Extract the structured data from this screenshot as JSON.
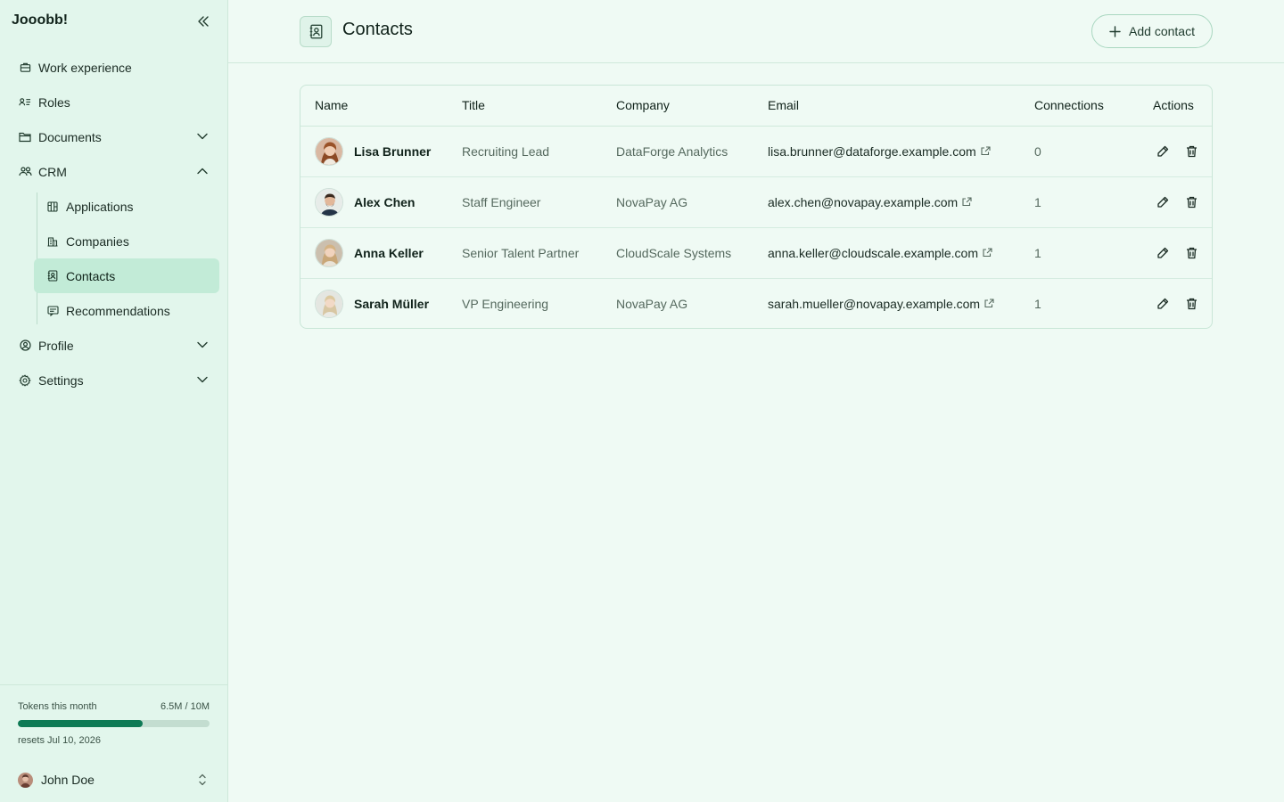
{
  "app": {
    "brand": "Jooobb!"
  },
  "sidebar": {
    "items": [
      {
        "label": "Work experience",
        "icon": "briefcase-icon"
      },
      {
        "label": "Roles",
        "icon": "roles-icon"
      },
      {
        "label": "Documents",
        "icon": "folder-icon",
        "expanded": false
      },
      {
        "label": "CRM",
        "icon": "users-icon",
        "expanded": true
      }
    ],
    "crm_children": [
      {
        "label": "Applications",
        "icon": "kanban-icon"
      },
      {
        "label": "Companies",
        "icon": "building-icon"
      },
      {
        "label": "Contacts",
        "icon": "contact-book-icon",
        "active": true
      },
      {
        "label": "Recommendations",
        "icon": "message-icon"
      }
    ],
    "items_after": [
      {
        "label": "Profile",
        "icon": "user-circle-icon",
        "expanded": false
      },
      {
        "label": "Settings",
        "icon": "gear-icon",
        "expanded": false
      }
    ],
    "usage": {
      "label": "Tokens this month",
      "value": "6.5M / 10M",
      "progress": 0.65,
      "reset_text": "resets Jul 10, 2026"
    },
    "user": {
      "name": "John Doe"
    }
  },
  "header": {
    "title": "Contacts",
    "add_button_label": "Add contact"
  },
  "table": {
    "columns": [
      "Name",
      "Title",
      "Company",
      "Email",
      "Connections",
      "Actions"
    ],
    "rows": [
      {
        "name": "Lisa Brunner",
        "title": "Recruiting Lead",
        "company": "DataForge Analytics",
        "email": "lisa.brunner@dataforge.example.com",
        "connections": "0"
      },
      {
        "name": "Alex Chen",
        "title": "Staff Engineer",
        "company": "NovaPay AG",
        "email": "alex.chen@novapay.example.com",
        "connections": "1"
      },
      {
        "name": "Anna Keller",
        "title": "Senior Talent Partner",
        "company": "CloudScale Systems",
        "email": "anna.keller@cloudscale.example.com",
        "connections": "1"
      },
      {
        "name": "Sarah Müller",
        "title": "VP Engineering",
        "company": "NovaPay AG",
        "email": "sarah.mueller@novapay.example.com",
        "connections": "1"
      }
    ]
  },
  "colors": {
    "accent": "#0e7a55",
    "sidebar_bg": "#e2f6ec",
    "page_bg": "#effaf4",
    "active_item_bg": "#c2ebd7"
  }
}
